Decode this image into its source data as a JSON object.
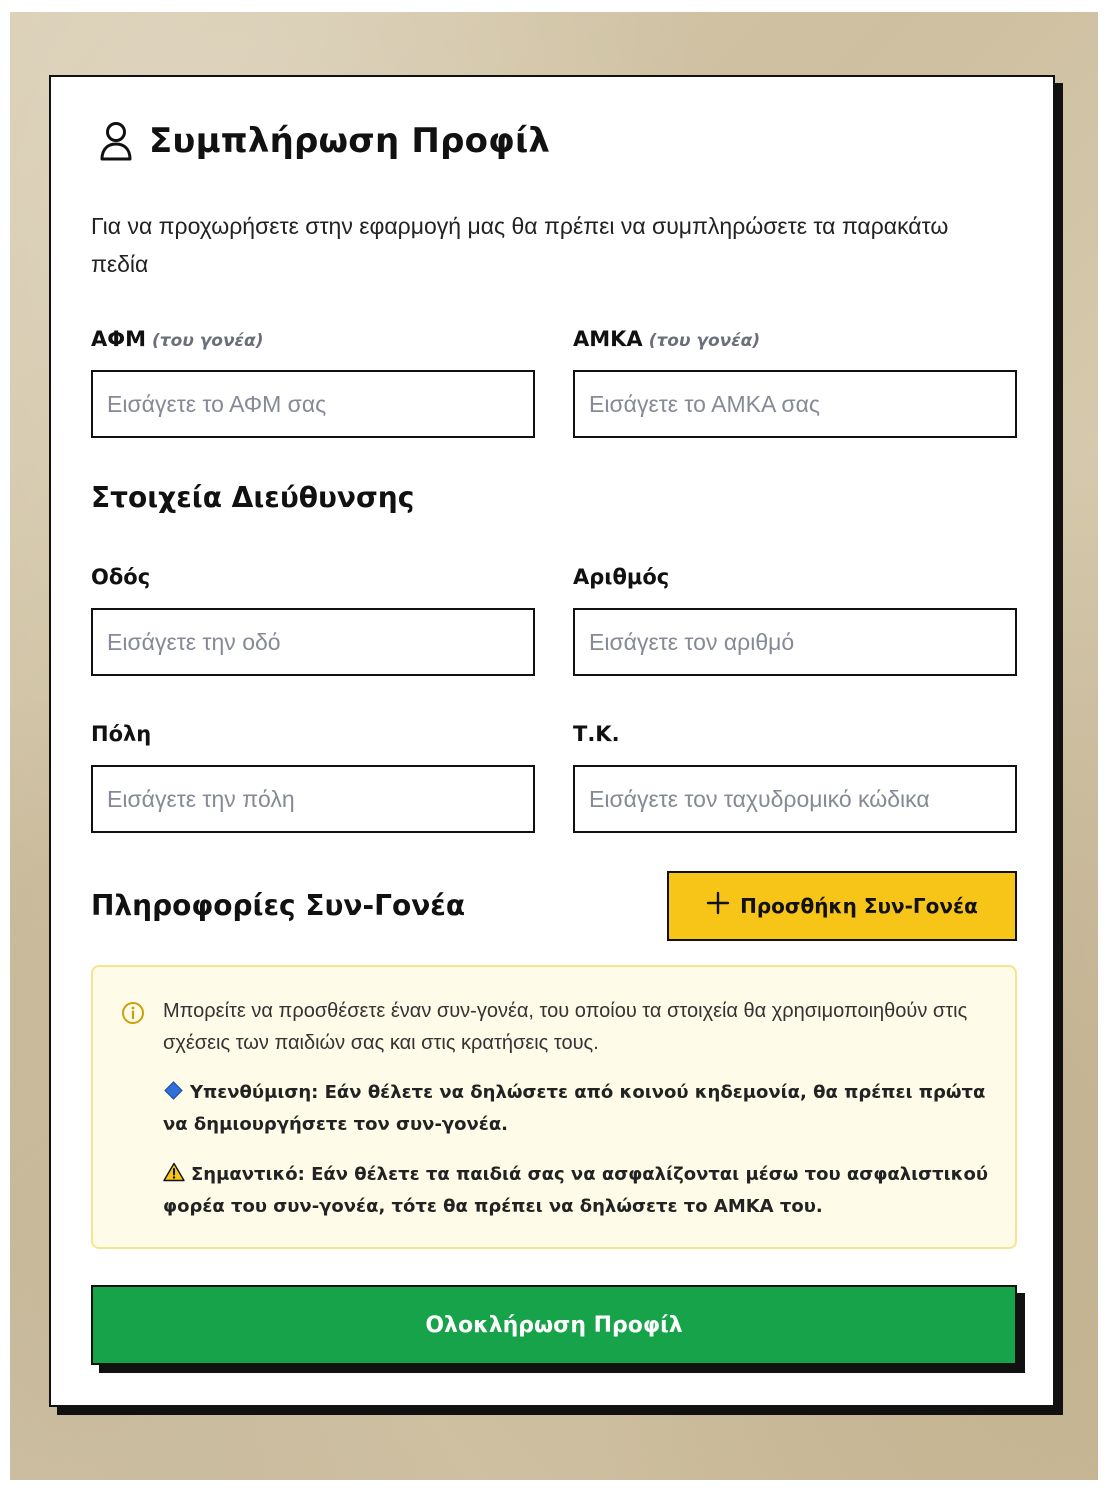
{
  "header": {
    "icon": "user-icon",
    "title": "Συμπλήρωση Προφίλ"
  },
  "intro": "Για να προχωρήσετε στην εφαρμογή μας θα πρέπει να συμπληρώσετε τα παρακάτω πεδία",
  "fields": {
    "afm": {
      "label": "ΑΦΜ",
      "hint": "(του γονέα)",
      "placeholder": "Εισάγετε το ΑΦΜ σας"
    },
    "amka": {
      "label": "ΑΜΚΑ",
      "hint": "(του γονέα)",
      "placeholder": "Εισάγετε το ΑΜΚΑ σας"
    }
  },
  "address": {
    "section_title": "Στοιχεία Διεύθυνσης",
    "street": {
      "label": "Οδός",
      "placeholder": "Εισάγετε την οδό"
    },
    "number": {
      "label": "Αριθμός",
      "placeholder": "Εισάγετε τον αριθμό"
    },
    "city": {
      "label": "Πόλη",
      "placeholder": "Εισάγετε την πόλη"
    },
    "postal_code": {
      "label": "Τ.Κ.",
      "placeholder": "Εισάγετε τον ταχυδρομικό κώδικα"
    }
  },
  "coparent": {
    "section_title": "Πληροφορίες Συν-Γονέα",
    "add_button": {
      "icon": "plus-icon",
      "label": "Προσθήκη Συν-Γονέα"
    },
    "info": {
      "icon": "info-icon",
      "text": "Μπορείτε να προσθέσετε έναν συν-γονέα, του οποίου τα στοιχεία θα χρησιμοποιηθούν στις σχέσεις των παιδιών σας και στις κρατήσεις τους.",
      "reminder": "Υπενθύμιση: Εάν θέλετε να δηλώσετε από κοινού κηδεμονία, θα πρέπει πρώτα να δημιουργήσετε τον συν-γονέα.",
      "important": "Σημαντικό: Εάν θέλετε τα παιδιά σας να ασφαλίζονται μέσω του ασφαλιστικού φορέα του συν-γονέα, τότε θα πρέπει να δηλώσετε το ΑΜΚΑ του."
    }
  },
  "submit_button": {
    "label": "Ολοκλήρωση Προφίλ"
  },
  "colors": {
    "accent_yellow": "#f7c518",
    "submit_green": "#16a34a",
    "info_bg": "#fefbe8",
    "info_border": "#f6e58d"
  }
}
